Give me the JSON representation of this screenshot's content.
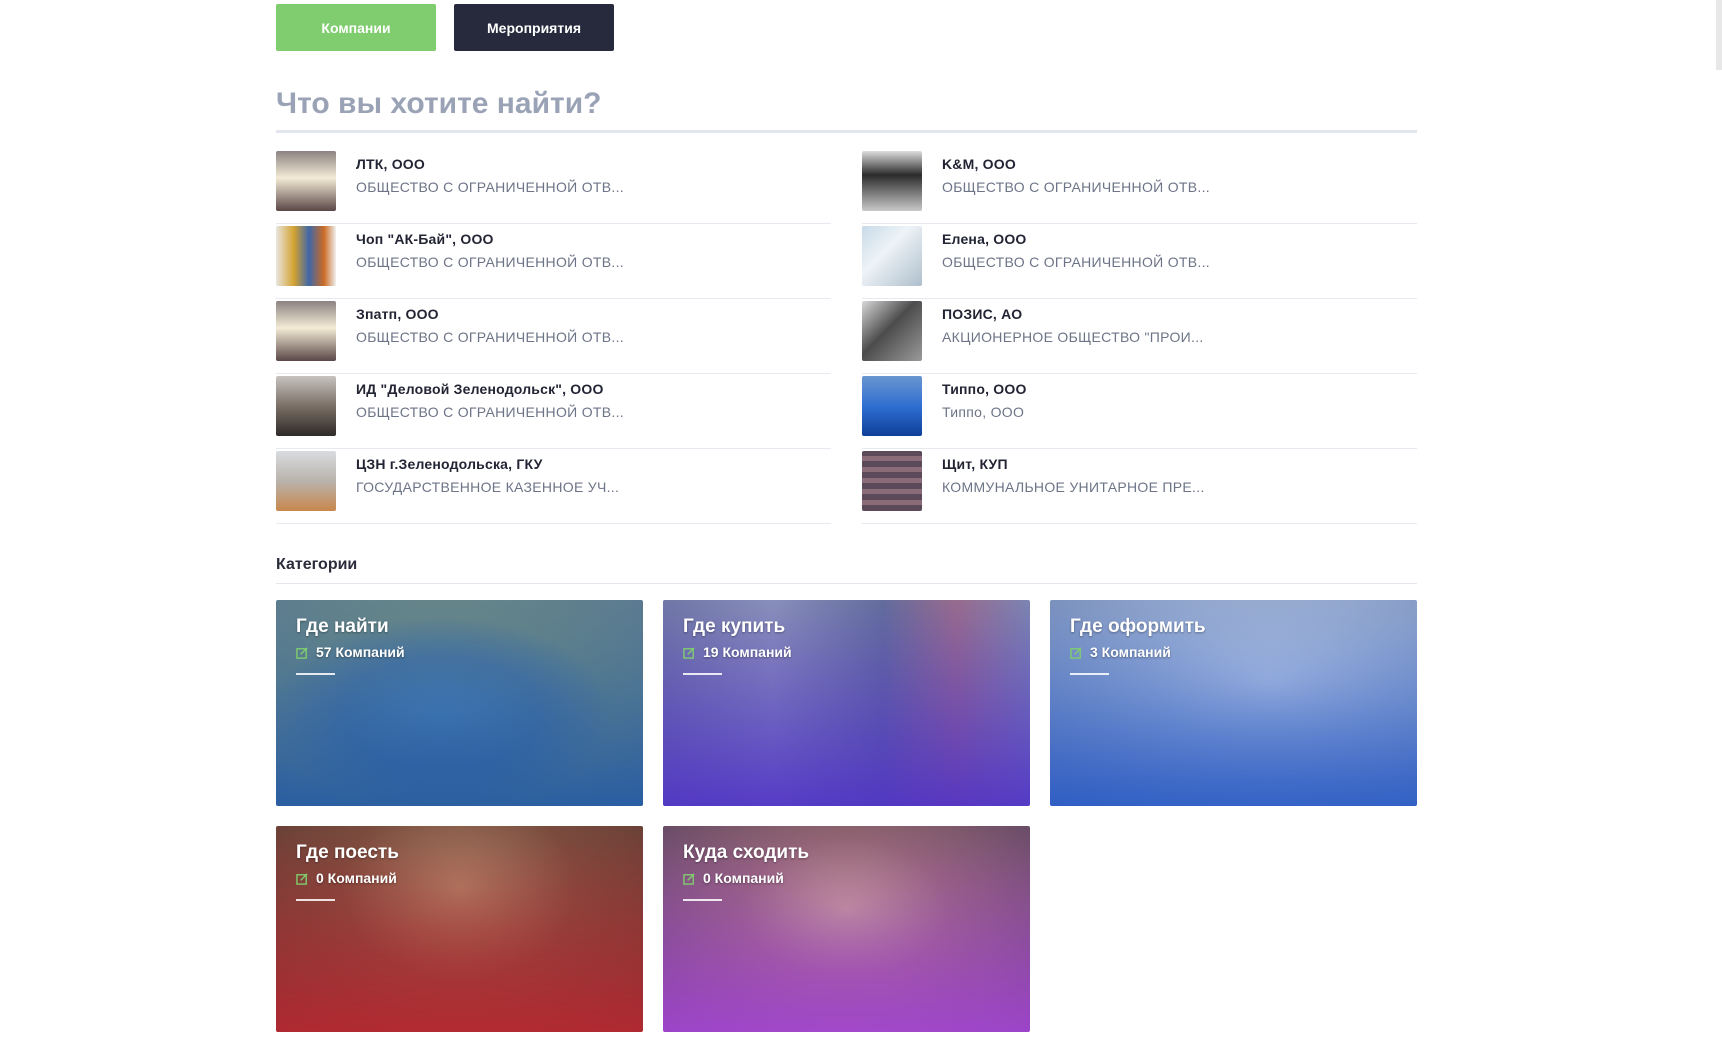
{
  "tabs": {
    "companies_label": "Компании",
    "events_label": "Мероприятия",
    "companies_color": "#7fcd6e",
    "events_color": "#262a3c"
  },
  "search": {
    "placeholder": "Что вы хотите найти?"
  },
  "companies": [
    {
      "name": "ЛТК, ООО",
      "desc": "ОБЩЕСТВО С ОГРАНИЧЕННОЙ ОТВ..."
    },
    {
      "name": "K&M, ООО",
      "desc": "ОБЩЕСТВО С ОГРАНИЧЕННОЙ ОТВ..."
    },
    {
      "name": "Чоп \"АК-Бай\", ООО",
      "desc": "ОБЩЕСТВО С ОГРАНИЧЕННОЙ ОТВ..."
    },
    {
      "name": "Елена, ООО",
      "desc": "ОБЩЕСТВО С ОГРАНИЧЕННОЙ ОТВ..."
    },
    {
      "name": "Зпатп, ООО",
      "desc": "ОБЩЕСТВО С ОГРАНИЧЕННОЙ ОТВ..."
    },
    {
      "name": "ПОЗИС, АО",
      "desc": "АКЦИОНЕРНОЕ ОБЩЕСТВО \"ПРОИ..."
    },
    {
      "name": "ИД \"Деловой Зеленодольск\", ООО",
      "desc": "ОБЩЕСТВО С ОГРАНИЧЕННОЙ ОТВ..."
    },
    {
      "name": "Типпо, ООО",
      "desc": "Типпо, ООО"
    },
    {
      "name": "ЦЗН г.Зеленодольска, ГКУ",
      "desc": "ГОСУДАРСТВЕННОЕ КАЗЕННОЕ УЧ..."
    },
    {
      "name": "Щит, КУП",
      "desc": "КОММУНАЛЬНОЕ УНИТАРНОЕ ПРЕ..."
    }
  ],
  "categories": {
    "heading": "Категории",
    "items": [
      {
        "title": "Где найти",
        "count": "57 Компаний"
      },
      {
        "title": "Где купить",
        "count": "19 Компаний"
      },
      {
        "title": "Где оформить",
        "count": "3 Компаний"
      },
      {
        "title": "Где поесть",
        "count": "0 Компаний"
      },
      {
        "title": "Куда сходить",
        "count": "0 Компаний"
      }
    ]
  }
}
